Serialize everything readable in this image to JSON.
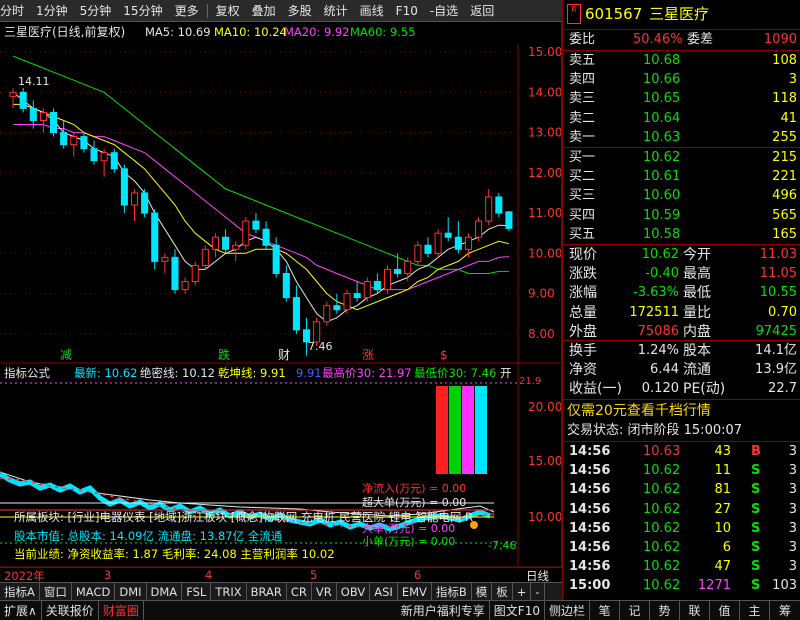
{
  "toolbar": {
    "items": [
      "分时",
      "1分钟",
      "5分钟",
      "15分钟",
      "更多",
      "复权",
      "叠加",
      "多股",
      "统计",
      "画线",
      "F10",
      "-自选",
      "返回"
    ]
  },
  "chart_header": {
    "title": "三星医疗(日线,前复权)",
    "ma5": "MA5: 10.69",
    "ma10": "MA10: 10.24",
    "ma20": "MA20: 9.92",
    "ma60": "MA60: 9.55"
  },
  "price_axis": [
    "15.00",
    "14.00",
    "13.00",
    "12.00",
    "11.00",
    "10.00",
    "9.00",
    "8.00"
  ],
  "annotations": {
    "high": "14.11",
    "low": "7.46",
    "markers": [
      "减",
      "跌",
      "财",
      "涨",
      "$"
    ]
  },
  "indicator_header": {
    "name": "指标公式",
    "latest": "最新: 10.62",
    "jueshi": "绝密线: 10.12",
    "qiankun": "乾坤线: 9.91",
    "v4": "9.91",
    "high30": "最高价30: 21.97",
    "low30": "最低价30: 7.46",
    "suffix": "开"
  },
  "indicator_axis": [
    "20.00",
    "15.00",
    "10.00"
  ],
  "indicator_axis_low": "-7.46",
  "indicator_axis_top": "21.9",
  "flow_labels": [
    "净流入(万元) = 0.00",
    "超大单(万元) = 0.00",
    "大单(万元) = 0.00",
    "小单(万元) = 0.00"
  ],
  "info_lines": {
    "line1": "所属板块: [行业]电器仪表 [地域]浙江板块 [概念]物联网 充电桩 民营医院 锂电 智能电网 R",
    "line2": "股本市值: 总股本: 14.09亿 流通盘: 13.87亿 全流通",
    "line3": "当前业绩: 净资收益率: 1.87 毛利率: 24.08 主营利润率 10.02"
  },
  "time_axis": {
    "year": "2022年",
    "m3": "3",
    "m4": "4",
    "m5": "5",
    "m6": "6",
    "right_label": "日线"
  },
  "bottom_tabs": [
    "指标A",
    "窗口",
    "MACD",
    "DMI",
    "DMA",
    "FSL",
    "TRIX",
    "BRAR",
    "CR",
    "VR",
    "OBV",
    "ASI",
    "EMV",
    "指标B",
    "模",
    "板",
    "+",
    "-"
  ],
  "status_bar": {
    "items": [
      "扩展∧",
      "关联报价",
      "财富圈"
    ],
    "right_items": [
      "新用户福利专享",
      "图文F10",
      "侧边栏"
    ],
    "panel_items": [
      "笔",
      "记",
      "势",
      "联",
      "值",
      "主",
      "筹"
    ]
  },
  "quote": {
    "code": "601567",
    "name": "三星医疗",
    "weibi_label": "委比",
    "weibi": "50.46%",
    "weicha_label": "委差",
    "weicha": "1090",
    "asks": [
      {
        "label": "卖五",
        "price": "10.68",
        "vol": "108"
      },
      {
        "label": "卖四",
        "price": "10.66",
        "vol": "3"
      },
      {
        "label": "卖三",
        "price": "10.65",
        "vol": "118"
      },
      {
        "label": "卖二",
        "price": "10.64",
        "vol": "41"
      },
      {
        "label": "卖一",
        "price": "10.63",
        "vol": "255"
      }
    ],
    "bids": [
      {
        "label": "买一",
        "price": "10.62",
        "vol": "215"
      },
      {
        "label": "买二",
        "price": "10.61",
        "vol": "221"
      },
      {
        "label": "买三",
        "price": "10.60",
        "vol": "496"
      },
      {
        "label": "买四",
        "price": "10.59",
        "vol": "565"
      },
      {
        "label": "买五",
        "price": "10.58",
        "vol": "165"
      }
    ],
    "stats": [
      {
        "l1": "现价",
        "v1": "10.62",
        "l2": "今开",
        "v2": "11.03"
      },
      {
        "l1": "涨跌",
        "v1": "-0.40",
        "l2": "最高",
        "v2": "11.05"
      },
      {
        "l1": "涨幅",
        "v1": "-3.63%",
        "l2": "最低",
        "v2": "10.55"
      },
      {
        "l1": "总量",
        "v1": "172511",
        "l2": "量比",
        "v2": "0.70"
      },
      {
        "l1": "外盘",
        "v1": "75086",
        "l2": "内盘",
        "v2": "97425"
      }
    ],
    "fin": [
      {
        "l1": "换手",
        "v1": "1.24%",
        "l2": "股本",
        "v2": "14.1亿"
      },
      {
        "l1": "净资",
        "v1": "6.44",
        "l2": "流通",
        "v2": "13.9亿"
      },
      {
        "l1": "收益(一)",
        "v1": "0.120",
        "l2": "PE(动)",
        "v2": "22.7"
      }
    ],
    "promo": "仅需20元查看千档行情",
    "trade_status": "交易状态: 闭市阶段 15:00:07",
    "ticks": [
      {
        "time": "14:56",
        "price": "10.63",
        "vol": "43",
        "side": "B",
        "n": "3"
      },
      {
        "time": "14:56",
        "price": "10.62",
        "vol": "11",
        "side": "S",
        "n": "3"
      },
      {
        "time": "14:56",
        "price": "10.62",
        "vol": "81",
        "side": "S",
        "n": "3"
      },
      {
        "time": "14:56",
        "price": "10.62",
        "vol": "27",
        "side": "S",
        "n": "3"
      },
      {
        "time": "14:56",
        "price": "10.62",
        "vol": "10",
        "side": "S",
        "n": "3"
      },
      {
        "time": "14:56",
        "price": "10.62",
        "vol": "6",
        "side": "S",
        "n": "3"
      },
      {
        "time": "14:56",
        "price": "10.62",
        "vol": "47",
        "side": "S",
        "n": "3"
      },
      {
        "time": "15:00",
        "price": "10.62",
        "vol": "1271",
        "side": "S",
        "n": "103"
      }
    ]
  },
  "chart_data": {
    "type": "candlestick",
    "ylim": [
      7.4,
      15.2
    ],
    "candles": [
      [
        13.9,
        14.1,
        13.6,
        14.0
      ],
      [
        14.0,
        14.11,
        13.5,
        13.6
      ],
      [
        13.6,
        13.8,
        13.1,
        13.3
      ],
      [
        13.3,
        13.6,
        13.0,
        13.5
      ],
      [
        13.5,
        13.6,
        12.9,
        13.0
      ],
      [
        13.0,
        13.3,
        12.6,
        12.7
      ],
      [
        12.7,
        13.0,
        12.4,
        12.9
      ],
      [
        12.9,
        13.0,
        12.5,
        12.6
      ],
      [
        12.6,
        12.8,
        12.2,
        12.3
      ],
      [
        12.3,
        12.6,
        11.9,
        12.5
      ],
      [
        12.5,
        12.6,
        12.0,
        12.1
      ],
      [
        12.1,
        12.2,
        11.0,
        11.2
      ],
      [
        11.2,
        11.6,
        10.8,
        11.5
      ],
      [
        11.5,
        11.6,
        10.9,
        11.0
      ],
      [
        11.0,
        11.1,
        9.6,
        9.8
      ],
      [
        9.8,
        10.0,
        9.5,
        9.9
      ],
      [
        9.9,
        10.1,
        9.0,
        9.1
      ],
      [
        9.1,
        9.4,
        9.0,
        9.3
      ],
      [
        9.3,
        9.8,
        9.2,
        9.7
      ],
      [
        9.7,
        10.2,
        9.6,
        10.1
      ],
      [
        10.1,
        10.5,
        9.9,
        10.4
      ],
      [
        10.4,
        10.6,
        10.0,
        10.1
      ],
      [
        10.1,
        10.3,
        9.8,
        10.2
      ],
      [
        10.2,
        10.9,
        10.1,
        10.8
      ],
      [
        10.8,
        11.0,
        10.5,
        10.6
      ],
      [
        10.6,
        10.8,
        10.1,
        10.2
      ],
      [
        10.2,
        10.4,
        9.4,
        9.5
      ],
      [
        9.5,
        9.7,
        8.8,
        8.9
      ],
      [
        8.9,
        9.2,
        8.0,
        8.1
      ],
      [
        8.1,
        8.4,
        7.46,
        7.8
      ],
      [
        7.8,
        8.4,
        7.7,
        8.3
      ],
      [
        8.3,
        8.8,
        8.2,
        8.7
      ],
      [
        8.7,
        9.0,
        8.5,
        8.6
      ],
      [
        8.6,
        9.1,
        8.5,
        9.0
      ],
      [
        9.0,
        9.3,
        8.8,
        8.9
      ],
      [
        8.9,
        9.4,
        8.8,
        9.3
      ],
      [
        9.3,
        9.5,
        9.0,
        9.1
      ],
      [
        9.1,
        9.7,
        9.0,
        9.6
      ],
      [
        9.6,
        10.0,
        9.4,
        9.5
      ],
      [
        9.5,
        9.9,
        9.3,
        9.8
      ],
      [
        9.8,
        10.3,
        9.7,
        10.2
      ],
      [
        10.2,
        10.4,
        9.9,
        10.0
      ],
      [
        10.0,
        10.6,
        9.9,
        10.5
      ],
      [
        10.5,
        10.9,
        10.3,
        10.4
      ],
      [
        10.4,
        10.8,
        10.0,
        10.1
      ],
      [
        10.1,
        10.5,
        9.9,
        10.4
      ],
      [
        10.4,
        10.9,
        10.3,
        10.8
      ],
      [
        10.8,
        11.6,
        10.7,
        11.4
      ],
      [
        11.4,
        11.5,
        10.9,
        11.0
      ],
      [
        11.03,
        11.05,
        10.55,
        10.62
      ]
    ],
    "ma5": [
      14.0,
      13.8,
      13.6,
      13.5,
      13.3,
      13.0,
      12.9,
      12.8,
      12.6,
      12.5,
      12.4,
      12.0,
      11.8,
      11.5,
      11.0,
      10.6,
      10.2,
      9.8,
      9.6,
      9.6,
      9.8,
      10.0,
      10.1,
      10.3,
      10.4,
      10.3,
      10.1,
      9.8,
      9.3,
      8.9,
      8.5,
      8.3,
      8.4,
      8.6,
      8.7,
      8.9,
      9.0,
      9.2,
      9.3,
      9.4,
      9.6,
      9.7,
      9.9,
      10.1,
      10.2,
      10.3,
      10.4,
      10.6,
      10.7,
      10.69
    ],
    "ma10": [
      13.7,
      13.7,
      13.6,
      13.5,
      13.4,
      13.3,
      13.2,
      13.0,
      12.9,
      12.8,
      12.7,
      12.5,
      12.3,
      12.1,
      11.8,
      11.5,
      11.2,
      10.8,
      10.5,
      10.3,
      10.1,
      10.0,
      10.0,
      10.0,
      10.1,
      10.1,
      10.1,
      10.0,
      9.8,
      9.6,
      9.3,
      9.0,
      8.8,
      8.7,
      8.6,
      8.7,
      8.8,
      8.9,
      9.0,
      9.1,
      9.3,
      9.4,
      9.6,
      9.7,
      9.8,
      10.0,
      10.1,
      10.2,
      10.3,
      10.24
    ],
    "ma20": [
      13.2,
      13.2,
      13.2,
      13.2,
      13.1,
      13.1,
      13.0,
      13.0,
      12.9,
      12.9,
      12.8,
      12.7,
      12.6,
      12.5,
      12.3,
      12.1,
      11.9,
      11.7,
      11.5,
      11.3,
      11.1,
      10.9,
      10.7,
      10.5,
      10.4,
      10.3,
      10.2,
      10.1,
      10.0,
      9.9,
      9.7,
      9.6,
      9.5,
      9.4,
      9.3,
      9.2,
      9.1,
      9.1,
      9.1,
      9.1,
      9.2,
      9.3,
      9.4,
      9.5,
      9.6,
      9.7,
      9.8,
      9.8,
      9.9,
      9.92
    ],
    "ma60": [
      14.9,
      14.8,
      14.7,
      14.6,
      14.5,
      14.4,
      14.3,
      14.2,
      14.1,
      14.0,
      13.8,
      13.6,
      13.4,
      13.2,
      13.0,
      12.8,
      12.6,
      12.4,
      12.2,
      12.0,
      11.8,
      11.6,
      11.5,
      11.4,
      11.3,
      11.2,
      11.1,
      11.0,
      10.9,
      10.8,
      10.7,
      10.6,
      10.5,
      10.4,
      10.3,
      10.2,
      10.1,
      10.0,
      9.9,
      9.8,
      9.7,
      9.7,
      9.6,
      9.6,
      9.6,
      9.5,
      9.5,
      9.5,
      9.55,
      9.55
    ]
  }
}
